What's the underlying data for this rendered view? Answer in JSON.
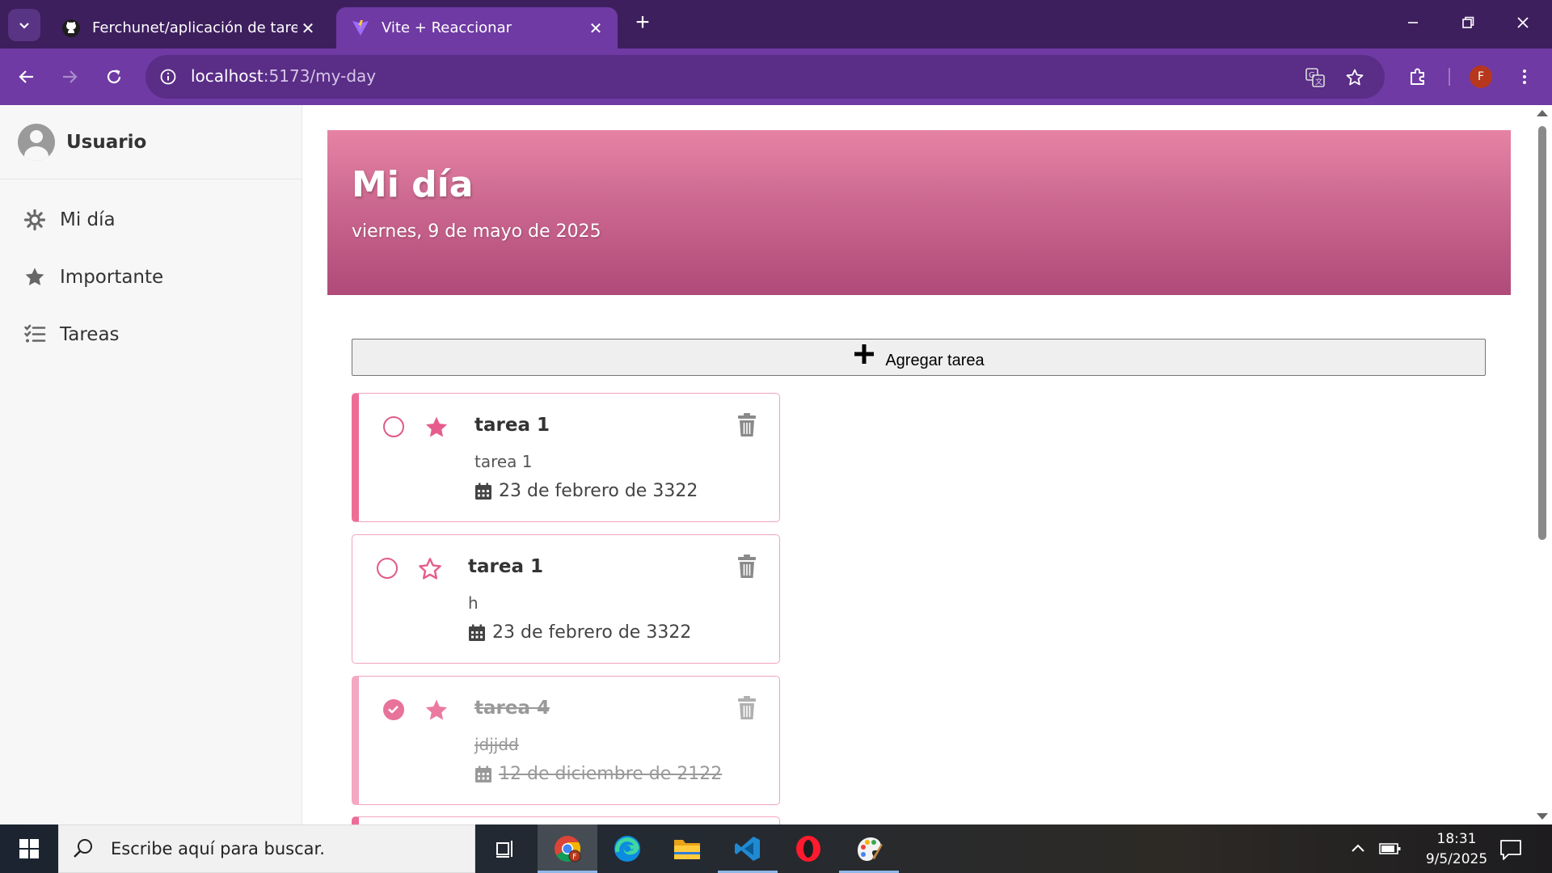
{
  "browser": {
    "tabs": [
      {
        "title": "Ferchunet/aplicación de tareas",
        "icon": "github-icon",
        "active": false
      },
      {
        "title": "Vite + Reaccionar",
        "icon": "vite-icon",
        "active": true
      }
    ],
    "url_host": "localhost",
    "url_path": ":5173/my-day",
    "profile_initial": "F",
    "colors": {
      "tabbar": "#3d1f5e",
      "toolbar": "#6f3aa4",
      "active_tab": "#6f3aa4"
    }
  },
  "sidebar": {
    "user_name": "Usuario",
    "items": [
      {
        "label": "Mi día",
        "icon": "sun-icon"
      },
      {
        "label": "Importante",
        "icon": "star-icon"
      },
      {
        "label": "Tareas",
        "icon": "list-icon"
      }
    ]
  },
  "main": {
    "title": "Mi día",
    "date": "viernes, 9 de mayo de 2025",
    "add_button_label": "Agregar tarea",
    "tasks": [
      {
        "title": "tarea 1",
        "description": "tarea 1",
        "due": "23 de febrero de 3322",
        "completed": false,
        "important": true
      },
      {
        "title": "tarea 1",
        "description": "h",
        "due": "23 de febrero de 3322",
        "completed": false,
        "important": false
      },
      {
        "title": "tarea 4",
        "description": "jdjjdd",
        "due": "12 de diciembre de 2122",
        "completed": true,
        "important": true
      }
    ],
    "colors": {
      "accent": "#e8739a",
      "hero_top": "#e683a4",
      "hero_bottom": "#b04a79"
    }
  },
  "taskbar": {
    "search_placeholder": "Escribe aquí para buscar.",
    "apps": [
      "task-view-icon",
      "chrome-icon",
      "edge-icon",
      "file-explorer-icon",
      "vscode-icon",
      "opera-icon",
      "paint-icon"
    ],
    "time": "18:31",
    "date": "9/5/2025"
  }
}
